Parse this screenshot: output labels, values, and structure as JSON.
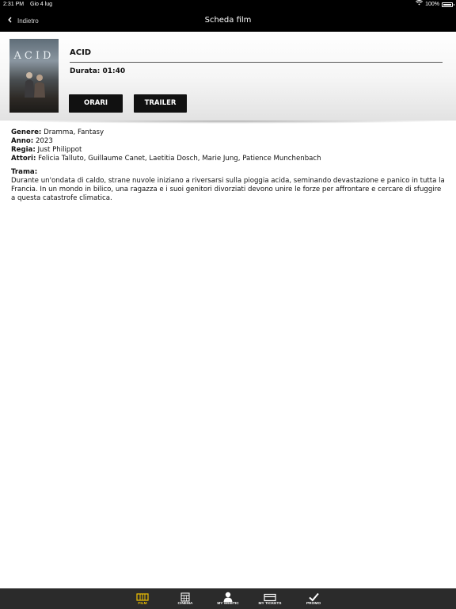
{
  "status_bar": {
    "time": "2:31 PM",
    "date": "Gio 4 lug",
    "battery": "100%"
  },
  "nav": {
    "back_label": "Indietro",
    "title": "Scheda film"
  },
  "film": {
    "title": "ACID",
    "duration": "Durata: 01:40",
    "poster_text": "ACID",
    "buttons": {
      "showtimes": "ORARI",
      "trailer": "TRAILER"
    }
  },
  "details": {
    "genre_label": "Genere:",
    "genre": "Dramma, Fantasy",
    "year_label": "Anno:",
    "year": "2023",
    "director_label": "Regia:",
    "director": "Just Philippot",
    "actors_label": "Attori:",
    "actors": "Felicia Talluto, Guillaume Canet, Laetitia Dosch, Marie Jung, Patience Munchenbach",
    "plot_label": "Trama:",
    "plot": "Durante un'ondata di caldo, strane nuvole iniziano a riversarsi sulla pioggia acida, seminando devastazione e panico in tutta la Francia. In un mondo in bilico, una ragazza e i suoi genitori divorziati devono unire le forze per affrontare e cercare di sfuggire a questa catastrofe climatica."
  },
  "tabs": [
    {
      "label": "FILM",
      "icon": "film-icon",
      "active": true
    },
    {
      "label": "CINEMA",
      "icon": "calendar-icon",
      "active": false
    },
    {
      "label": "MY WEBTIC",
      "icon": "user-icon",
      "active": false
    },
    {
      "label": "MY TICKETS",
      "icon": "ticket-icon",
      "active": false
    },
    {
      "label": "PROMO",
      "icon": "check-icon",
      "active": false
    }
  ],
  "colors": {
    "active_tab": "#f2c200",
    "bar_background": "#000000",
    "tab_bar_background": "#2b2b2b"
  }
}
